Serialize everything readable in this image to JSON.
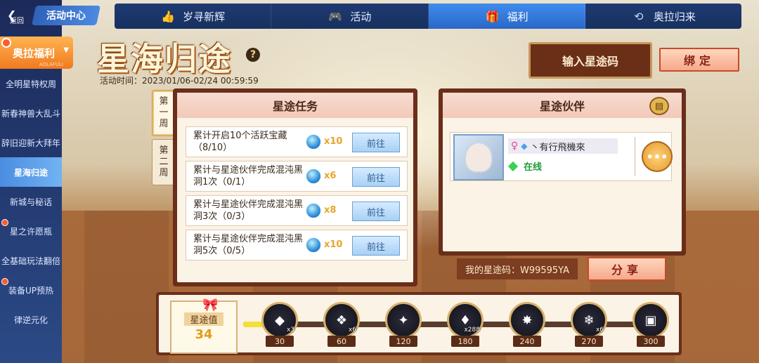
{
  "sidebar": {
    "back_label": "返回",
    "center_title": "活动中心",
    "category": {
      "label": "奥拉福利",
      "sub": "AOLAFULI"
    },
    "items": [
      {
        "label": "全明星特权周",
        "badge": false,
        "active": false
      },
      {
        "label": "新春神兽大乱斗",
        "badge": false,
        "active": false
      },
      {
        "label": "辞旧迎新大拜年",
        "badge": false,
        "active": false
      },
      {
        "label": "星海归途",
        "badge": false,
        "active": true
      },
      {
        "label": "新城与秘话",
        "badge": false,
        "active": false
      },
      {
        "label": "星之许愿瓶",
        "badge": true,
        "active": false
      },
      {
        "label": "全基础玩法翻倍",
        "badge": false,
        "active": false
      },
      {
        "label": "装备UP预热",
        "badge": true,
        "active": false
      },
      {
        "label": "律逆元化",
        "badge": false,
        "active": false
      }
    ]
  },
  "topnav": {
    "tabs": [
      {
        "label": "岁寻新辉",
        "icon": "thumbs-up-icon",
        "glyph": "👍",
        "active": false
      },
      {
        "label": "活动",
        "icon": "gamepad-icon",
        "glyph": "🎮",
        "active": false
      },
      {
        "label": "福利",
        "icon": "gift-icon",
        "glyph": "🎁",
        "active": true
      },
      {
        "label": "奥拉归来",
        "icon": "return-icon",
        "glyph": "⟲",
        "active": false
      }
    ]
  },
  "header": {
    "title": "星海归途",
    "time": "活动时间：2023/01/06-02/24 00:59:59",
    "code_input_label": "输入星途码",
    "bind_label": "绑定"
  },
  "weeks": [
    {
      "label": [
        "第",
        "一",
        "周"
      ],
      "active": true
    },
    {
      "label": [
        "第",
        "二",
        "周"
      ],
      "active": false
    }
  ],
  "tasks": {
    "title": "星途任务",
    "items": [
      {
        "desc": "累计开启10个活跃宝藏（8/10）",
        "qty": "x10",
        "button": "前往"
      },
      {
        "desc": "累计与星途伙伴完成混沌黑洞1次（0/1）",
        "qty": "x6",
        "button": "前往"
      },
      {
        "desc": "累计与星途伙伴完成混沌黑洞3次（0/3）",
        "qty": "x8",
        "button": "前往"
      },
      {
        "desc": "累计与星途伙伴完成混沌黑洞5次（0/5）",
        "qty": "x10",
        "button": "前往"
      }
    ]
  },
  "partner": {
    "title": "星途伙伴",
    "name": "丶有行飛機來",
    "status": "在线",
    "my_code": "我的星途码：W99595YA",
    "share_label": "分享"
  },
  "progress": {
    "label": "星途值",
    "value": "34",
    "current": 34,
    "max": 300,
    "rewards": [
      {
        "threshold": "30",
        "qty": "x3",
        "icon": "crystal-icon",
        "glyph": "◆"
      },
      {
        "threshold": "60",
        "qty": "x6",
        "icon": "gem-cube-icon",
        "glyph": "❖"
      },
      {
        "threshold": "120",
        "qty": "",
        "icon": "fox-mask-icon",
        "glyph": "✦"
      },
      {
        "threshold": "180",
        "qty": "x288",
        "icon": "red-gem-icon",
        "glyph": "♦"
      },
      {
        "threshold": "240",
        "qty": "",
        "icon": "golden-badge-icon",
        "glyph": "✸"
      },
      {
        "threshold": "270",
        "qty": "x6",
        "icon": "blue-orb-icon",
        "glyph": "❄"
      },
      {
        "threshold": "300",
        "qty": "",
        "icon": "portrait-frame-icon",
        "glyph": "▣"
      }
    ]
  },
  "colors": {
    "sidebar": "#1c2a5a",
    "active_tab": "#3f8cee",
    "board_frame": "#6a2e1a",
    "accent_orange": "#f07a1e",
    "progress_fill": "#f2e03a"
  }
}
